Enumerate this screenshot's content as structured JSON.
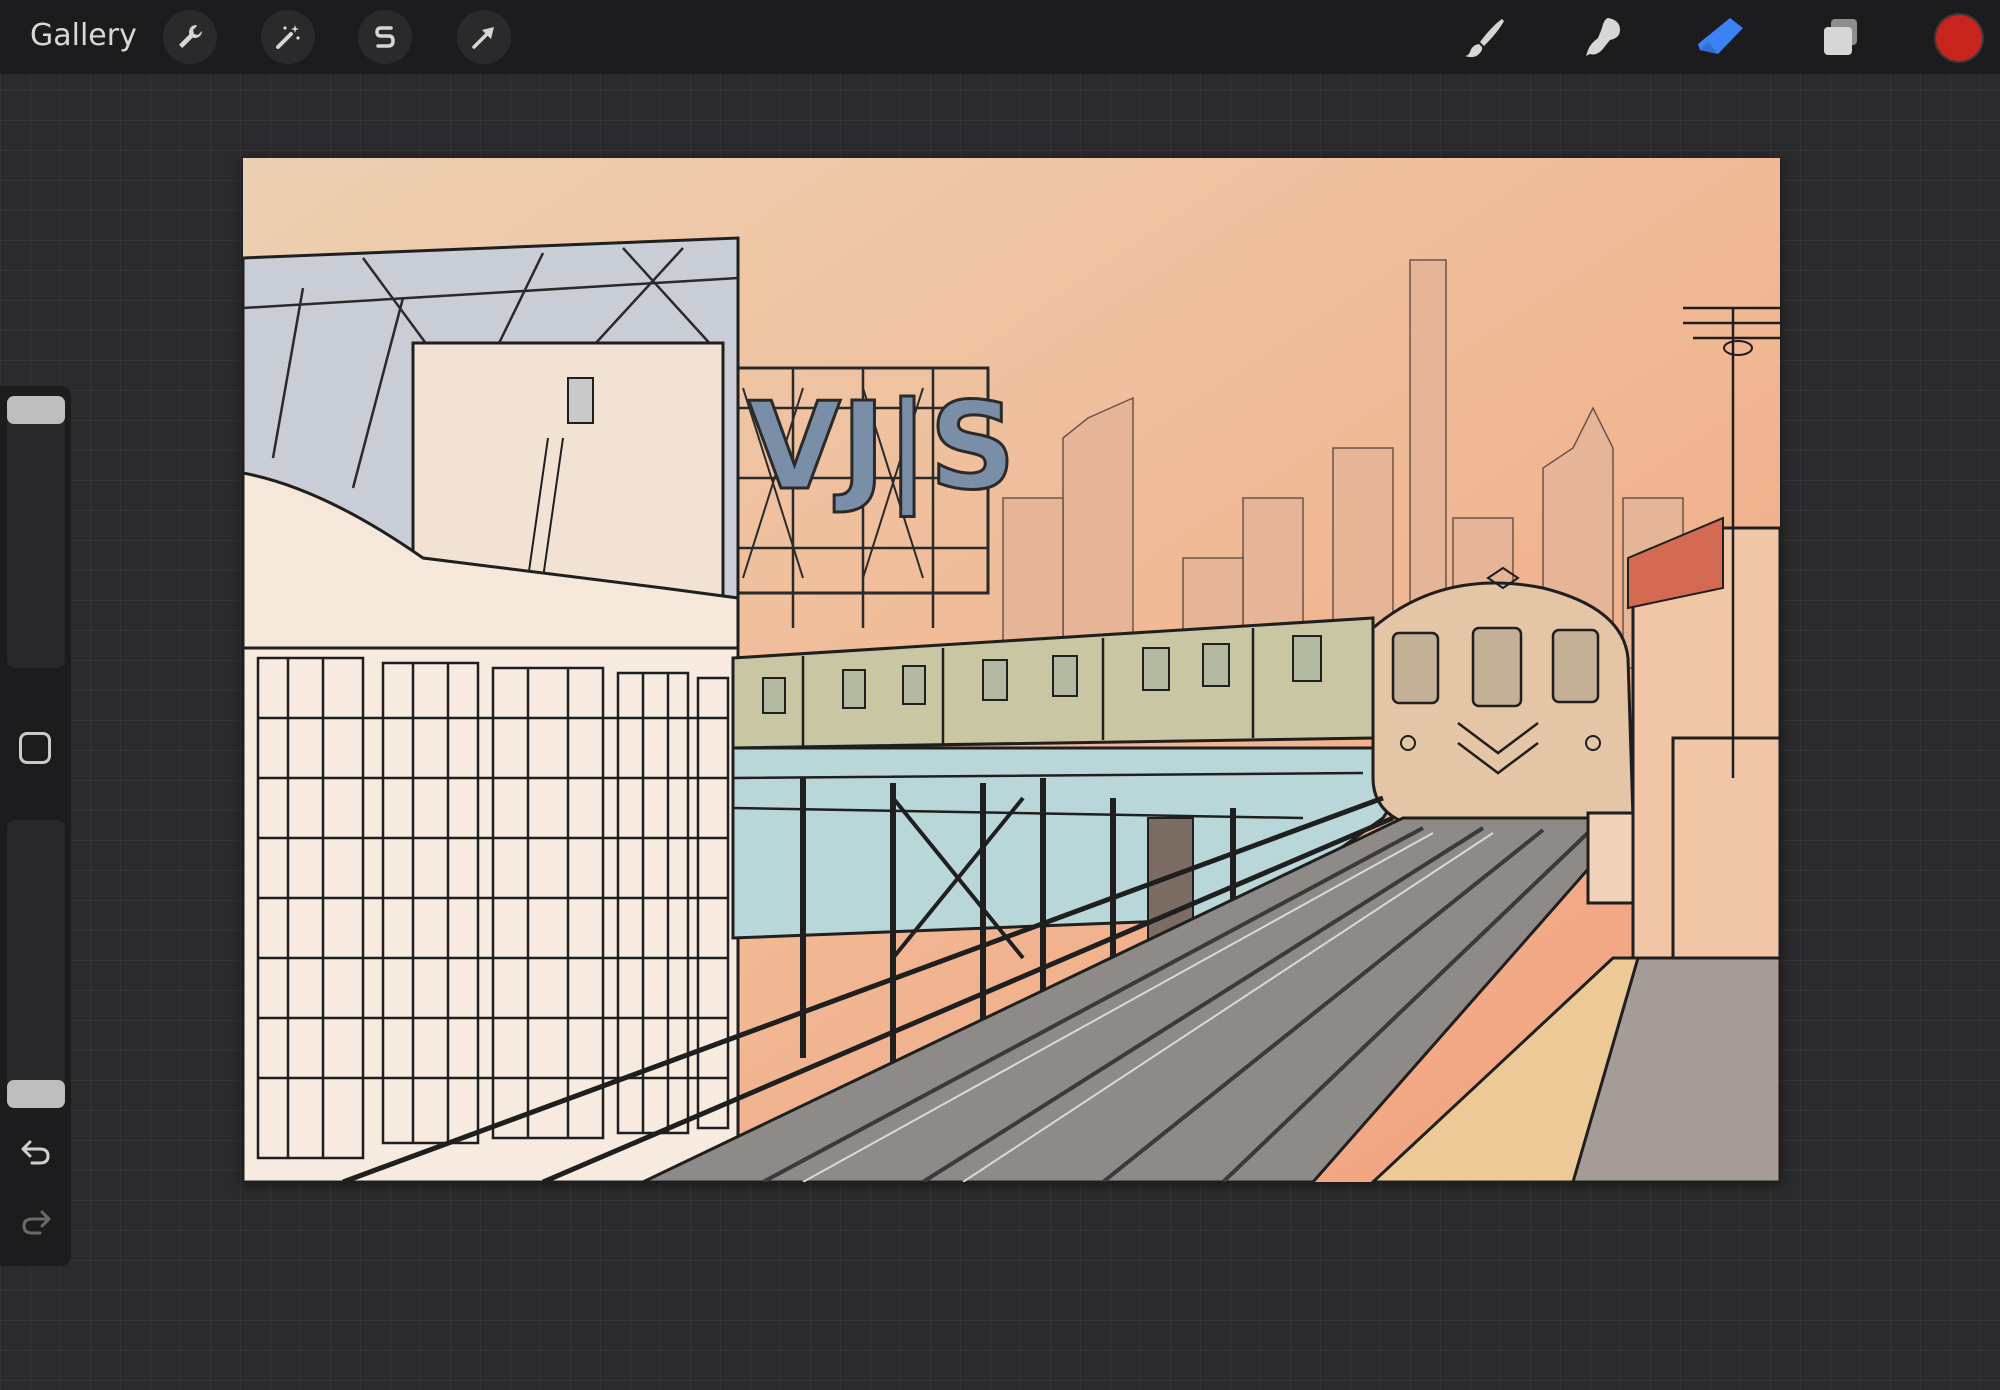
{
  "topbar": {
    "gallery_label": "Gallery",
    "left_tools": [
      "wrench-icon",
      "magic-wand-icon",
      "selection-s-icon",
      "transform-arrow-icon"
    ],
    "right_tools": [
      "brush-icon",
      "smudge-icon",
      "eraser-icon",
      "layers-icon"
    ],
    "active_tool": "eraser-icon",
    "accent_color": "#3b82f6",
    "current_color": "#c6241d"
  },
  "sidebar": {
    "controls": [
      "brush-size-slider",
      "modify-square-button",
      "opacity-slider",
      "undo-icon",
      "redo-icon"
    ]
  },
  "canvas": {
    "artwork": "illustration-elevated-subway-train",
    "sign_text": "VJ|S",
    "sky_colors": [
      "#f3d1b0",
      "#f0b392"
    ]
  }
}
